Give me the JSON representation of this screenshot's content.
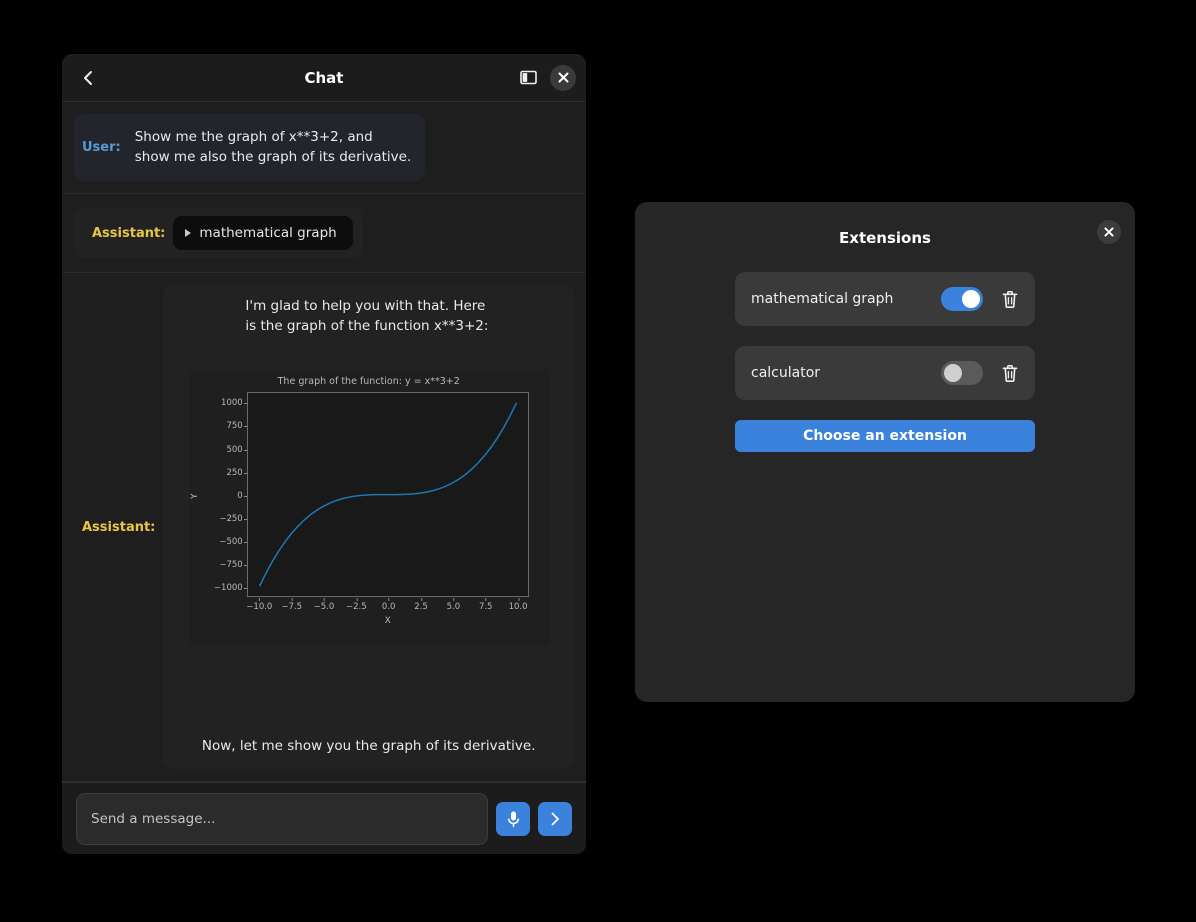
{
  "chat": {
    "title": "Chat",
    "back_icon": "chevron-left-icon",
    "split_view_icon": "split-view-icon",
    "close_icon": "close-icon",
    "messages": [
      {
        "role_label": "User:",
        "lines": [
          "Show me the graph of x**3+2, and",
          "show me also the graph of its derivative."
        ]
      },
      {
        "role_label": "Assistant:",
        "tool_chip": "mathematical graph",
        "tool_chip_icon": "disclosure-triangle-icon"
      },
      {
        "role_label": "Assistant:",
        "text_top_lines": [
          "I'm glad to help you with that. Here",
          "is the graph of the function x**3+2:"
        ],
        "text_bottom": "Now, let me show you the graph of its derivative."
      }
    ],
    "input": {
      "placeholder": "Send a message...",
      "value": "",
      "mic_icon": "microphone-icon",
      "send_icon": "send-chevron-icon"
    }
  },
  "chart_data": {
    "type": "line",
    "title": "The graph of the function: y = x**3+2",
    "xlabel": "X",
    "ylabel": "Y",
    "xlim": [
      -10.9,
      10.9
    ],
    "ylim": [
      -1110,
      1110
    ],
    "grid": false,
    "legend": null,
    "line_color": "#1f77b4",
    "xticks": [
      "−10.0",
      "−7.5",
      "−5.0",
      "−2.5",
      "0.0",
      "2.5",
      "5.0",
      "7.5",
      "10.0"
    ],
    "xtick_values": [
      -10,
      -7.5,
      -5,
      -2.5,
      0,
      2.5,
      5,
      7.5,
      10
    ],
    "yticks": [
      "1000",
      "750",
      "500",
      "250",
      "0",
      "−250",
      "−500",
      "−750",
      "−1000"
    ],
    "ytick_values": [
      1000,
      750,
      500,
      250,
      0,
      -250,
      -500,
      -750,
      -1000
    ],
    "series": [
      {
        "name": "y = x**3+2",
        "x": [
          -10,
          -9.5,
          -9,
          -8.5,
          -8,
          -7.5,
          -7,
          -6.5,
          -6,
          -5.5,
          -5,
          -4.5,
          -4,
          -3.5,
          -3,
          -2.5,
          -2,
          -1.5,
          -1,
          -0.5,
          0,
          0.5,
          1,
          1.5,
          2,
          2.5,
          3,
          3.5,
          4,
          4.5,
          5,
          5.5,
          6,
          6.5,
          7,
          7.5,
          8,
          8.5,
          9,
          9.5,
          10
        ],
        "y": [
          -998,
          -855.4,
          -727,
          -612.1,
          -510,
          -419.9,
          -341,
          -272.6,
          -214,
          -164.4,
          -123,
          -89.1,
          -62,
          -40.9,
          -25,
          -13.6,
          -6,
          -1.4,
          1,
          1.9,
          2,
          2.1,
          3,
          5.4,
          10,
          17.6,
          29,
          44.9,
          66,
          93.1,
          127,
          168.4,
          218,
          276.6,
          345,
          423.9,
          514,
          616.1,
          731,
          859.4,
          1002
        ]
      }
    ]
  },
  "extensions": {
    "title": "Extensions",
    "close_icon": "close-icon",
    "items": [
      {
        "name": "mathematical graph",
        "enabled_label": "on",
        "delete_icon": "trash-icon"
      },
      {
        "name": "calculator",
        "enabled_label": "off",
        "delete_icon": "trash-icon"
      }
    ],
    "choose_button": "Choose an extension"
  },
  "colors": {
    "accent_blue": "#3b82dd",
    "user_label": "#5b9bd5",
    "assistant_label": "#e8c547",
    "plot_line": "#1f77b4"
  }
}
